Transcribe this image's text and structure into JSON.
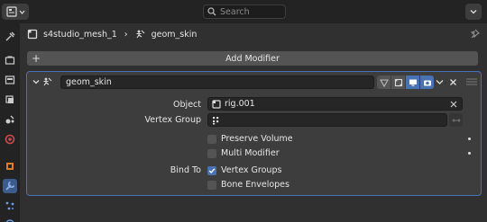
{
  "search": {
    "placeholder": "Search"
  },
  "breadcrumb": {
    "object": "s4studio_mesh_1",
    "modifier": "geom_skin"
  },
  "add_modifier": {
    "label": "Add Modifier"
  },
  "modifier": {
    "name": "geom_skin",
    "object_label": "Object",
    "object_value": "rig.001",
    "vertex_group_label": "Vertex Group",
    "vertex_group_value": "",
    "preserve_volume": {
      "label": "Preserve Volume",
      "checked": false
    },
    "multi_modifier": {
      "label": "Multi Modifier",
      "checked": false
    },
    "bind_to_label": "Bind To",
    "vertex_groups": {
      "label": "Vertex Groups",
      "checked": true
    },
    "bone_envelopes": {
      "label": "Bone Envelopes",
      "checked": false
    }
  },
  "colors": {
    "accent": "#4772b3",
    "panel": "#3d3d3d",
    "background": "#303030",
    "header": "#232323"
  },
  "sidebar": {
    "icons": [
      "tool-icon",
      "render-icon",
      "output-icon",
      "view-layer-icon",
      "scene-icon",
      "world-icon",
      "object-icon",
      "modifier-icon",
      "particles-icon",
      "physics-icon"
    ]
  }
}
